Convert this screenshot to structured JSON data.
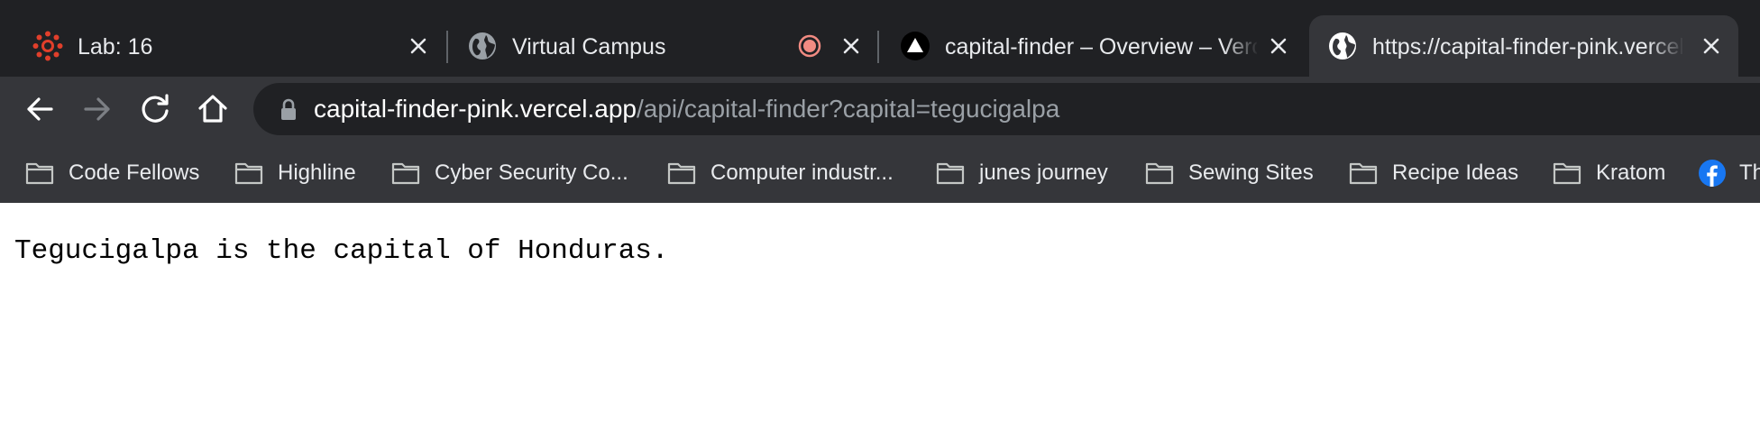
{
  "tabs": [
    {
      "title": "Lab: 16",
      "favicon": "canvas-logo-icon"
    },
    {
      "title": "Virtual Campus",
      "favicon": "globe-icon",
      "indicator": "recording-icon"
    },
    {
      "title": "capital-finder – Overview – Vercel",
      "favicon": "vercel-logo-icon"
    },
    {
      "title": "https://capital-finder-pink.vercel.app",
      "favicon": "globe-icon",
      "active": true
    }
  ],
  "omnibox": {
    "host": "capital-finder-pink.vercel.app",
    "path": "/api/capital-finder?capital=tegucigalpa"
  },
  "bookmarks": [
    {
      "label": "Code Fellows",
      "icon": "folder-icon"
    },
    {
      "label": "Highline",
      "icon": "folder-icon"
    },
    {
      "label": "Cyber Security Co...",
      "icon": "folder-icon"
    },
    {
      "label": "Computer industr...",
      "icon": "folder-icon"
    },
    {
      "label": "junes journey",
      "icon": "folder-icon"
    },
    {
      "label": "Sewing Sites",
      "icon": "folder-icon"
    },
    {
      "label": "Recipe Ideas",
      "icon": "folder-icon"
    },
    {
      "label": "Kratom",
      "icon": "folder-icon"
    },
    {
      "label": "Th",
      "icon": "facebook-icon"
    }
  ],
  "page": {
    "text": "Tegucigalpa is the capital of Honduras."
  },
  "colors": {
    "tabstrip": "#202124",
    "toolbar": "#35363a",
    "omnibox": "#202124",
    "text_light": "#e8eaed",
    "url_path": "#9aa0a6",
    "canvas_red": "#e13f2b",
    "recording": "#f28b82",
    "facebook_blue": "#1877f2"
  }
}
